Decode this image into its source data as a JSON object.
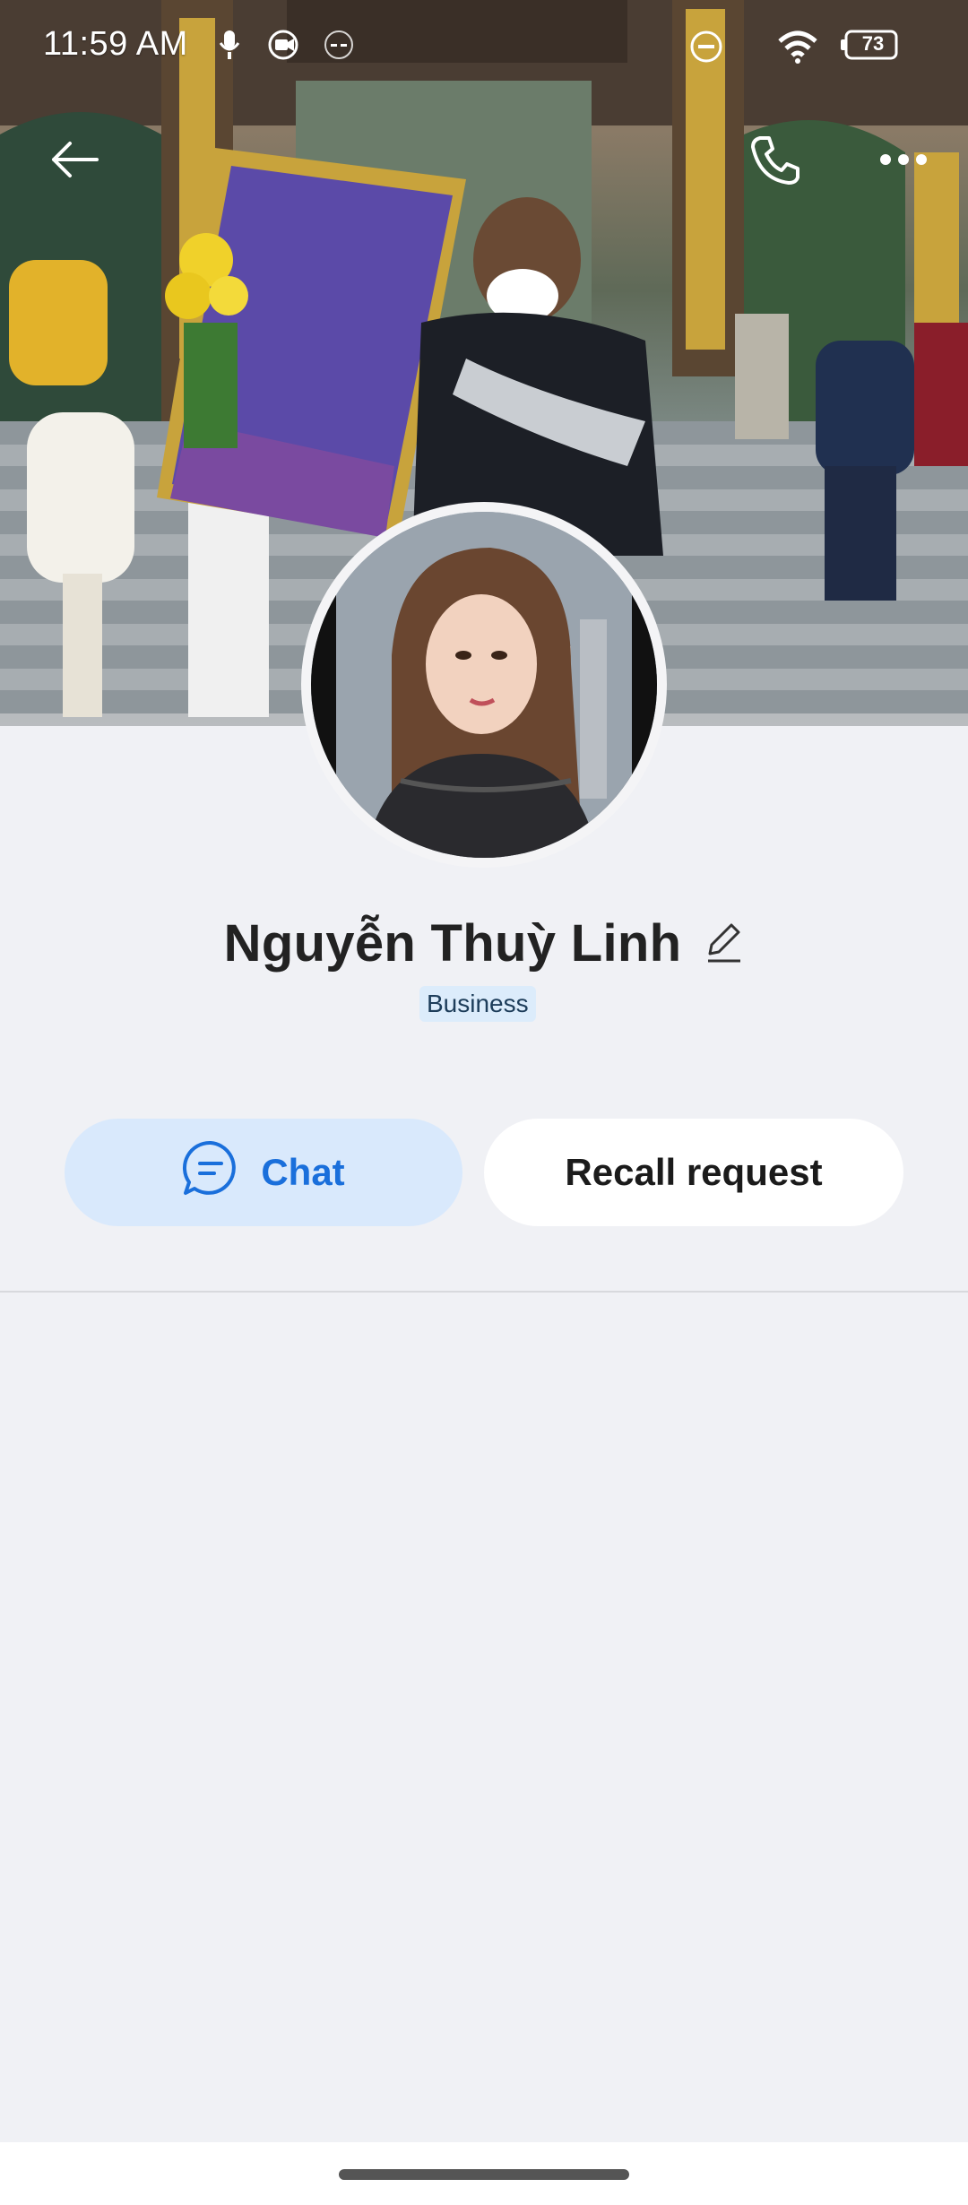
{
  "status_bar": {
    "time": "11:59 AM",
    "battery": "73",
    "icons": [
      "mic-icon",
      "video-record-icon",
      "dashes-icon",
      "do-not-disturb-icon",
      "wifi-icon",
      "battery-icon"
    ]
  },
  "nav": {
    "back_icon": "arrow-left-icon",
    "call_icon": "phone-icon",
    "more_icon": "more-horizontal-icon"
  },
  "profile": {
    "name": "Nguyễn Thuỳ Linh",
    "badge": "Business"
  },
  "actions": {
    "chat_label": "Chat",
    "recall_label": "Recall request"
  },
  "colors": {
    "accent": "#1a6fdb",
    "chat_bg": "#d9e9fc",
    "page_bg": "#f0f1f5"
  }
}
